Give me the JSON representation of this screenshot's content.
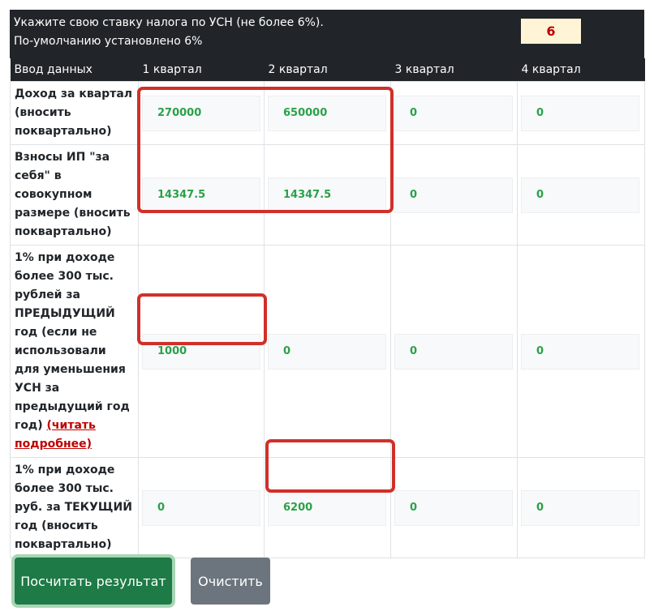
{
  "header": {
    "line1": "Укажите свою ставку налога по УСН (не более 6%).",
    "line2": "По-умолчанию установлено 6%",
    "rate_value": "6"
  },
  "table": {
    "columns": [
      "Ввод данных",
      "1 квартал",
      "2 квартал",
      "3 квартал",
      "4 квартал"
    ],
    "rows": [
      {
        "label": "Доход за квартал (вносить поквартально)",
        "link": "",
        "values": [
          "270000",
          "650000",
          "0",
          "0"
        ]
      },
      {
        "label": "Взносы ИП \"за себя\" в совокупном размере (вносить поквартально)",
        "link": "",
        "values": [
          "14347.5",
          "14347.5",
          "0",
          "0"
        ]
      },
      {
        "label": "1% при доходе более 300 тыс. рублей за ПРЕДЫДУЩИЙ год (если не использовали для уменьшения УСН за предыдущий год год)",
        "link": "(читать подробнее)",
        "values": [
          "1000",
          "0",
          "0",
          "0"
        ]
      },
      {
        "label": "1% при доходе более 300 тыс. руб. за ТЕКУЩИЙ год (вносить поквартально)",
        "link": "",
        "values": [
          "0",
          "6200",
          "0",
          "0"
        ]
      }
    ]
  },
  "buttons": {
    "calculate": "Посчитать результат",
    "clear": "Очистить"
  },
  "colors": {
    "header_bg": "#212529",
    "value_green": "#2aa14a",
    "highlight_red": "#d0302a",
    "primary_button": "#1e7a46",
    "secondary_button": "#6c757d"
  }
}
